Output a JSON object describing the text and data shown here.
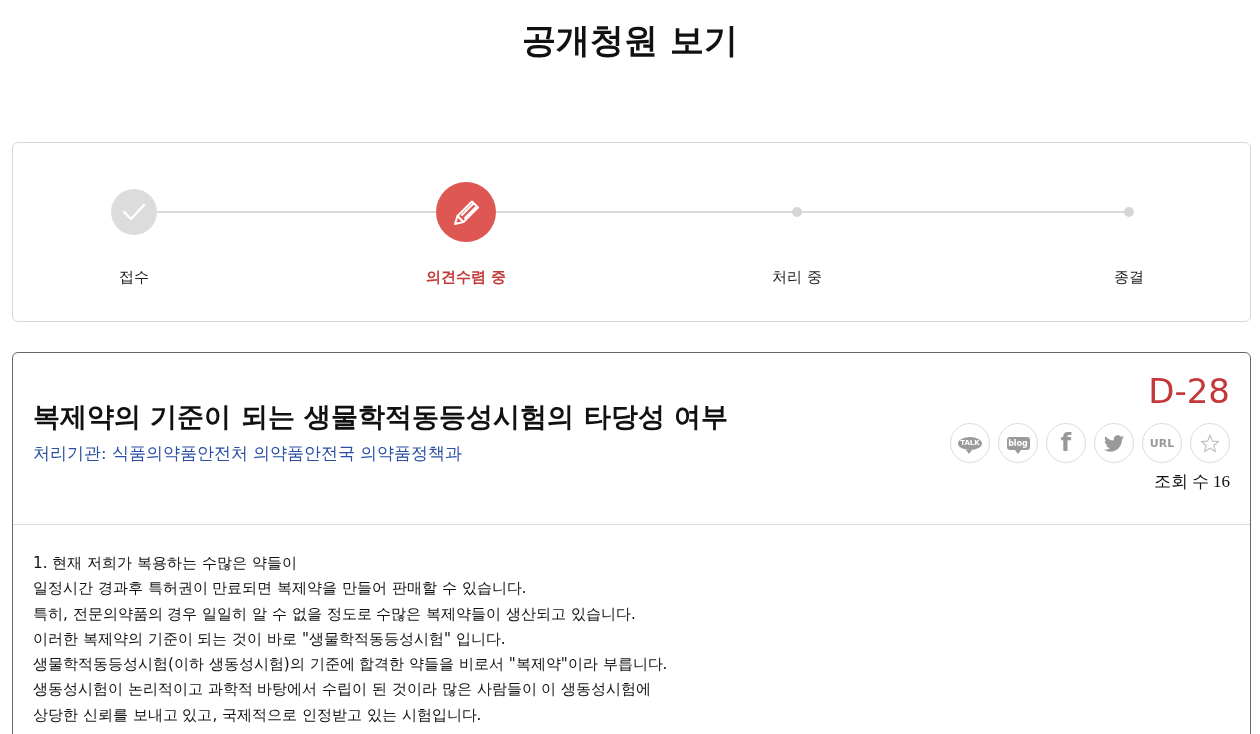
{
  "page": {
    "title": "공개청원 보기"
  },
  "progress": {
    "steps": [
      {
        "label": "접수",
        "completed": true,
        "selected": false
      },
      {
        "label": "의견수렴 중",
        "completed": false,
        "selected": true
      },
      {
        "label": "처리 중",
        "completed": false,
        "selected": false
      },
      {
        "label": "종결",
        "completed": false,
        "selected": false
      }
    ]
  },
  "petition": {
    "title": "복제약의 기준이 되는 생물학적동등성시험의 타당성 여부",
    "agency": "처리기관: 식품의약품안전처 의약품안전국 의약품정책과",
    "deadline": "D-28",
    "share_buttons": [
      {
        "kind": "kakaotalk",
        "label": "TALK"
      },
      {
        "kind": "blog",
        "label": "blog"
      },
      {
        "kind": "facebook",
        "label": "f"
      },
      {
        "kind": "twitter"
      },
      {
        "kind": "url",
        "label": "URL"
      },
      {
        "kind": "bookmark"
      }
    ],
    "views": "조회 수 16",
    "body_lines": [
      "1. 현재 저희가 복용하는 수많은 약들이",
      "일정시간 경과후 특허권이 만료되면 복제약을 만들어 판매할 수 있습니다.",
      "특히, 전문의약품의 경우 일일히 알 수 없을 정도로 수많은 복제약들이 생산되고 있습니다.",
      "이러한 복제약의 기준이 되는 것이 바로 \"생물학적동등성시험\" 입니다.",
      "생물학적동등성시험(이하 생동성시험)의 기준에 합격한 약들을 비로서 \"복제약\"이라 부릅니다.",
      "생동성시험이 논리적이고 과학적 바탕에서 수립이 된 것이라 많은 사람들이 이 생동성시험에",
      "상당한 신뢰를 보내고 있고, 국제적으로 인정받고 있는 시험입니다."
    ]
  }
}
